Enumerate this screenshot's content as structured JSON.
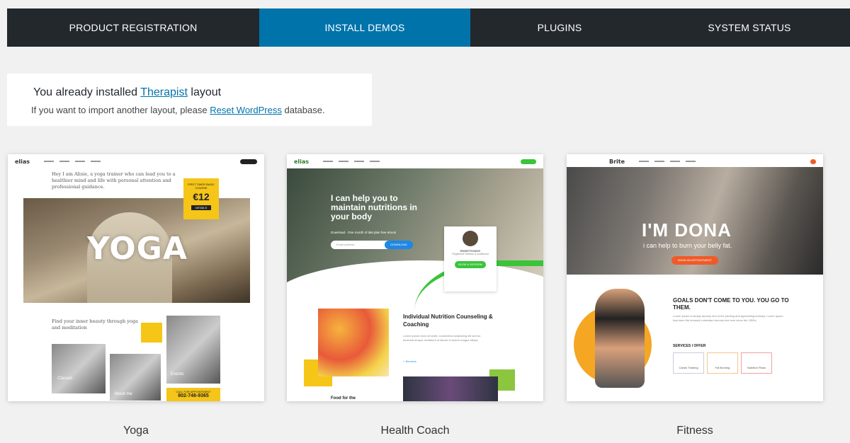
{
  "tabs": [
    {
      "label": "PRODUCT REGISTRATION",
      "active": false
    },
    {
      "label": "INSTALL DEMOS",
      "active": true
    },
    {
      "label": "PLUGINS",
      "active": false
    },
    {
      "label": "SYSTEM STATUS",
      "active": false
    }
  ],
  "colors": {
    "tab_bg": "#23282d",
    "tab_active": "#0073aa",
    "link": "#0073aa",
    "page_bg": "#f1f1f1"
  },
  "notice": {
    "line1_prefix": "You already installed",
    "line1_link": "Therapist",
    "line1_suffix": "layout",
    "line2_prefix": "If you want to import another layout, please",
    "line2_link": "Reset WordPress",
    "line2_suffix": "database."
  },
  "demos": [
    {
      "name": "Yoga",
      "preview": {
        "logo": "elias",
        "intro": "Hey I am Alisie, a yoga trainer who can lead you to a healthier mind and life with personal attention and professional guidance.",
        "hero_word": "YOGA",
        "badge_top": "FIRST TIMER BASIC COURSE",
        "badge_price": "€12",
        "badge_btn": "DETAILS",
        "subheading": "Find your inner beauty through yoga and meditation",
        "tiles": [
          "Classes",
          "About me",
          "Events"
        ],
        "call_label": "CALL FOR APPOINTMENT",
        "call_number": "802-748-9365"
      }
    },
    {
      "name": "Health Coach",
      "preview": {
        "logo": "elias",
        "hero_title": "I can help you to maintain nutritions in your body",
        "hero_line": "Download - One month of diet plan free ebook",
        "input_placeholder": "Email address",
        "input_btn": "DOWNLOAD",
        "person_name": "Daniel Kraven",
        "person_role": "Registered Dietitian & Nutritionist",
        "person_btn": "BOOK A SESSION",
        "section_title": "Individual Nutrition Counseling & Coaching",
        "section_text": "Lorem ipsum dolor sit amet, consectetur adipiscing elit sed do eiusmod tempor incididunt ut labore et dolore magna aliqua.",
        "section_link": "+ Services",
        "tag": "Food for the"
      }
    },
    {
      "name": "Fitness",
      "preview": {
        "logo": "Brite",
        "hero_title": "I'M DONA",
        "hero_sub": "i can help to burn your belly fat.",
        "hero_btn": "BOOK AN APPOINTMENT",
        "goal_title": "GOALS DON'T COME TO YOU. YOU GO TO THEM.",
        "goal_text": "Lorem Ipsum is simply dummy text of the printing and typesetting industry. Lorem Ipsum has been the industry's standard dummy text ever since the 1500s.",
        "services_title": "SERVICES I OFFER",
        "services": [
          "Cardio Training",
          "Fat Burning",
          "Nutrition Plans"
        ]
      }
    }
  ]
}
